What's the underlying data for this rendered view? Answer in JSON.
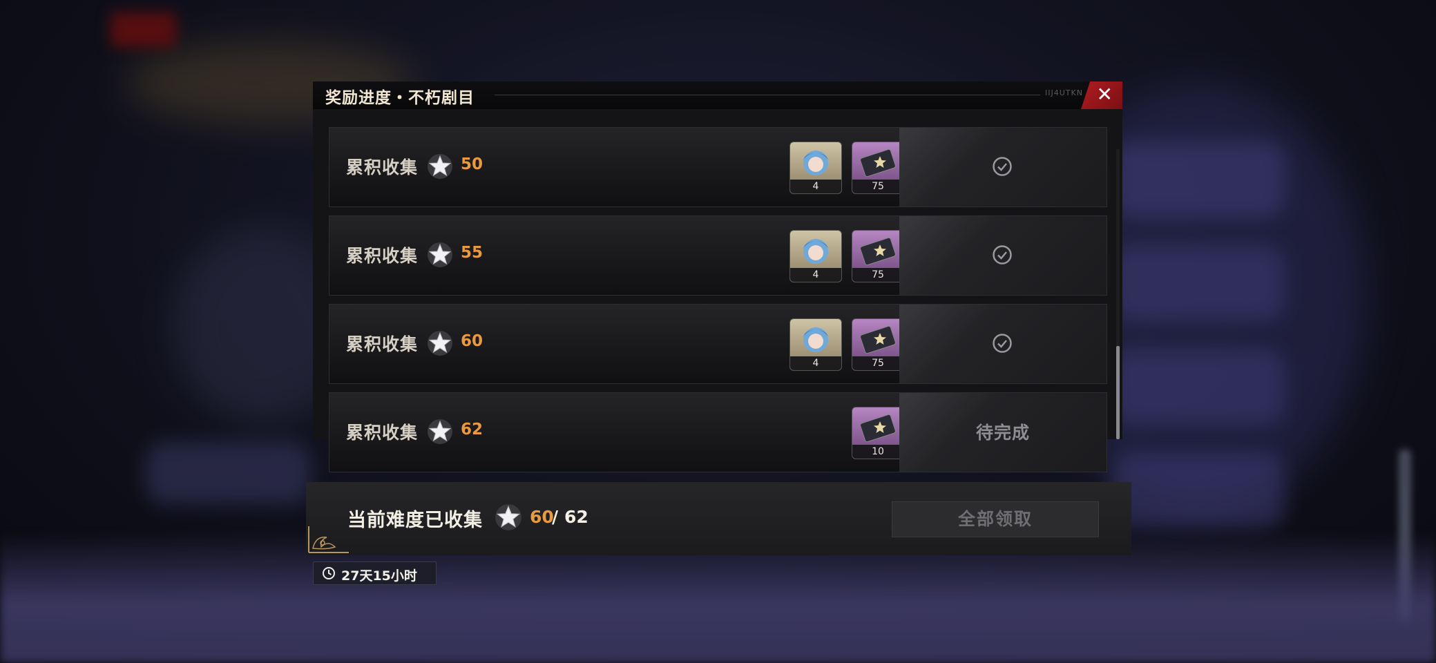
{
  "dialog": {
    "title": "奖励进度・不朽剧目",
    "title_mark": "IIJ4UTKN",
    "close_icon": "close-icon"
  },
  "rows": [
    {
      "label": "累积收集",
      "count": "50",
      "rewards": [
        {
          "type": "character-shard",
          "qty": "4"
        },
        {
          "type": "ticket",
          "qty": "75"
        }
      ],
      "status": "claimed",
      "status_icon": "check-circle-icon"
    },
    {
      "label": "累积收集",
      "count": "55",
      "rewards": [
        {
          "type": "character-shard",
          "qty": "4"
        },
        {
          "type": "ticket",
          "qty": "75"
        }
      ],
      "status": "claimed",
      "status_icon": "check-circle-icon"
    },
    {
      "label": "累积收集",
      "count": "60",
      "rewards": [
        {
          "type": "character-shard",
          "qty": "4"
        },
        {
          "type": "ticket",
          "qty": "75"
        }
      ],
      "status": "claimed",
      "status_icon": "check-circle-icon"
    },
    {
      "label": "累积收集",
      "count": "62",
      "rewards": [
        {
          "type": "ticket",
          "qty": "10"
        }
      ],
      "status": "pending",
      "status_text": "待完成"
    }
  ],
  "footer": {
    "label": "当前难度已收集",
    "current": "60",
    "separator": "/",
    "total": "62",
    "claim_all_label": "全部领取"
  },
  "timer": {
    "text": "27天15小时",
    "icon": "clock-icon"
  },
  "colors": {
    "accent_orange": "#e99a40",
    "close_red": "#b01d22",
    "title_text": "#f1e7d2"
  }
}
